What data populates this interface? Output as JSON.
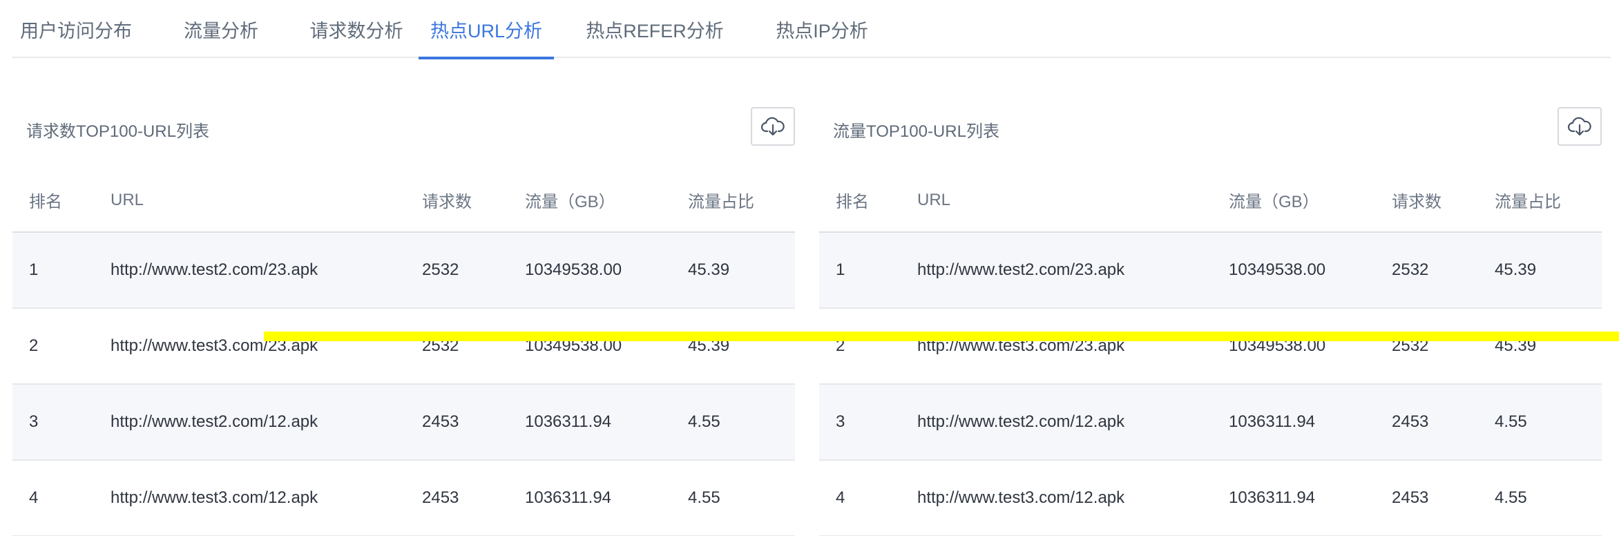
{
  "tabs": [
    {
      "label": "用户访问分布",
      "active": false
    },
    {
      "label": "流量分析",
      "active": false
    },
    {
      "label": "请求数分析",
      "active": false
    },
    {
      "label": "热点URL分析",
      "active": true
    },
    {
      "label": "热点REFER分析",
      "active": false
    },
    {
      "label": "热点IP分析",
      "active": false
    }
  ],
  "left_panel": {
    "title": "请求数TOP100-URL列表",
    "download_icon": "cloud-download-icon",
    "columns": [
      "排名",
      "URL",
      "请求数",
      "流量（GB）",
      "流量占比"
    ],
    "rows": [
      [
        "1",
        "http://www.test2.com/23.apk",
        "2532",
        "10349538.00",
        "45.39"
      ],
      [
        "2",
        "http://www.test3.com/23.apk",
        "2532",
        "10349538.00",
        "45.39"
      ],
      [
        "3",
        "http://www.test2.com/12.apk",
        "2453",
        "1036311.94",
        "4.55"
      ],
      [
        "4",
        "http://www.test3.com/12.apk",
        "2453",
        "1036311.94",
        "4.55"
      ]
    ]
  },
  "right_panel": {
    "title": "流量TOP100-URL列表",
    "download_icon": "cloud-download-icon",
    "columns": [
      "排名",
      "URL",
      "流量（GB）",
      "请求数",
      "流量占比"
    ],
    "rows": [
      [
        "1",
        "http://www.test2.com/23.apk",
        "10349538.00",
        "2532",
        "45.39"
      ],
      [
        "2",
        "http://www.test3.com/23.apk",
        "10349538.00",
        "2532",
        "45.39"
      ],
      [
        "3",
        "http://www.test2.com/12.apk",
        "1036311.94",
        "2453",
        "4.55"
      ],
      [
        "4",
        "http://www.test3.com/12.apk",
        "1036311.94",
        "2453",
        "4.55"
      ]
    ]
  },
  "colors": {
    "accent": "#3b76de",
    "tab_text": "#5f6b7a",
    "striped_row": "#f6f7fa"
  }
}
